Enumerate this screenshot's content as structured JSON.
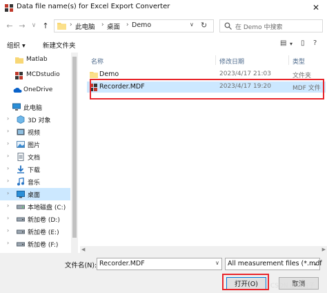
{
  "window": {
    "title": "Data file name(s) for Excel Export Converter",
    "close_glyph": "✕"
  },
  "navigation": {
    "back_glyph": "←",
    "forward_glyph": "→",
    "recent_glyph": "∨",
    "up_glyph": "↑",
    "breadcrumb": [
      "此电脑",
      "桌面",
      "Demo"
    ],
    "search_placeholder": "在 Demo 中搜索"
  },
  "toolbar": {
    "organize_label": "组织 ▾",
    "new_folder_label": "新建文件夹"
  },
  "sidebar": {
    "items": [
      {
        "label": "Matlab",
        "icon": "folder-icon"
      },
      {
        "label": "MCDstudio",
        "icon": "app-icon"
      },
      {
        "label": "OneDrive",
        "icon": "cloud-icon"
      },
      {
        "label": "此电脑",
        "icon": "computer-icon"
      },
      {
        "label": "3D 对象",
        "icon": "cube-icon"
      },
      {
        "label": "视频",
        "icon": "video-icon"
      },
      {
        "label": "图片",
        "icon": "picture-icon"
      },
      {
        "label": "文档",
        "icon": "document-icon"
      },
      {
        "label": "下载",
        "icon": "download-icon"
      },
      {
        "label": "音乐",
        "icon": "music-icon"
      },
      {
        "label": "桌面",
        "icon": "desktop-icon",
        "selected": true
      },
      {
        "label": "本地磁盘 (C:)",
        "icon": "drive-icon"
      },
      {
        "label": "新加卷 (D:)",
        "icon": "drive-icon"
      },
      {
        "label": "新加卷 (E:)",
        "icon": "drive-icon"
      },
      {
        "label": "新加卷 (F:)",
        "icon": "drive-icon"
      }
    ]
  },
  "file_list": {
    "columns": [
      "名称",
      "修改日期",
      "类型"
    ],
    "rows": [
      {
        "name": "Demo",
        "date": "2023/4/17 21:03",
        "type": "文件夹",
        "icon": "folder-icon"
      },
      {
        "name": "Recorder.MDF",
        "date": "2023/4/17 19:20",
        "type": "MDF 文件",
        "icon": "mdf-file-icon",
        "selected": true
      }
    ]
  },
  "bottom": {
    "filename_label": "文件名(N):",
    "filename_value": "Recorder.MDF",
    "filetype_value": "All measurement files (*.mdf",
    "open_label": "打开(O)",
    "cancel_label": "取消",
    "watermark": "CSDN @枯古子"
  },
  "colors": {
    "selection": "#cce8ff",
    "highlight_border": "#e8242a",
    "accent": "#0078d7"
  }
}
